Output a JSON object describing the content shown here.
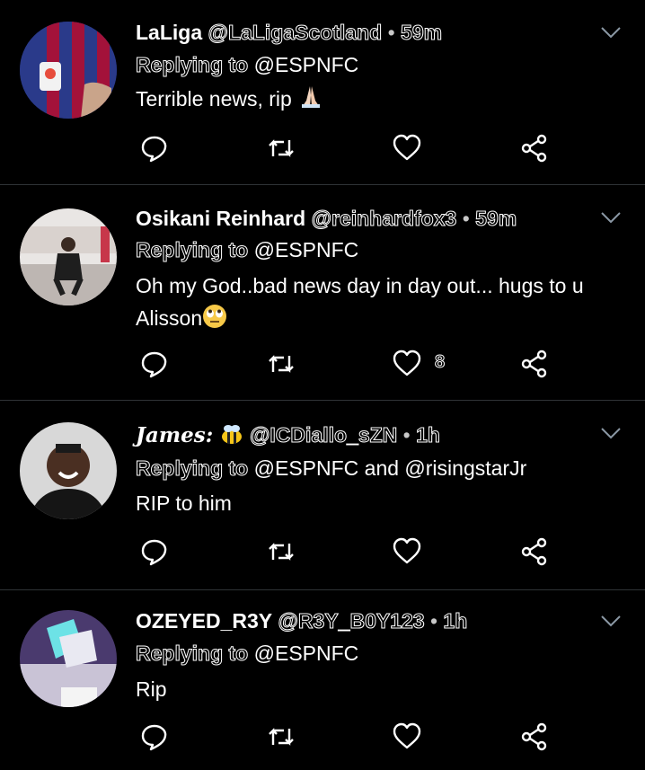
{
  "tweets": [
    {
      "name": "LaLiga",
      "handle": "@LaLigaScotland",
      "time": "59m",
      "reply_prefix": "Replying to",
      "reply_target": "@ESPNFC",
      "text": "Terrible news, rip",
      "emoji": "folded-hands",
      "like_count": ""
    },
    {
      "name": "Osikani Reinhard",
      "handle": "@reinhardfox3",
      "time": "59m",
      "reply_prefix": "Replying to",
      "reply_target": "@ESPNFC",
      "text": "Oh my God..bad news day in day out... hugs to u Alisson",
      "emoji": "face-with-rolling-eyes",
      "like_count": "8"
    },
    {
      "name": "James:",
      "name_emoji": "bee",
      "handle": "@ICDiallo_sZN",
      "time": "1h",
      "reply_prefix": "Replying to",
      "reply_target": "@ESPNFC and @risingstarJr",
      "text": "RIP to him",
      "like_count": ""
    },
    {
      "name": "OZEYED_R3Y",
      "handle": "@R3Y_B0Y123",
      "time": "1h",
      "reply_prefix": "Replying to",
      "reply_target": "@ESPNFC",
      "text": "Rip",
      "like_count": ""
    }
  ],
  "separator": "•",
  "colors": {
    "background": "#000000",
    "text": "#ffffff",
    "icon": "#ffffff",
    "divider": "#2f3336"
  }
}
